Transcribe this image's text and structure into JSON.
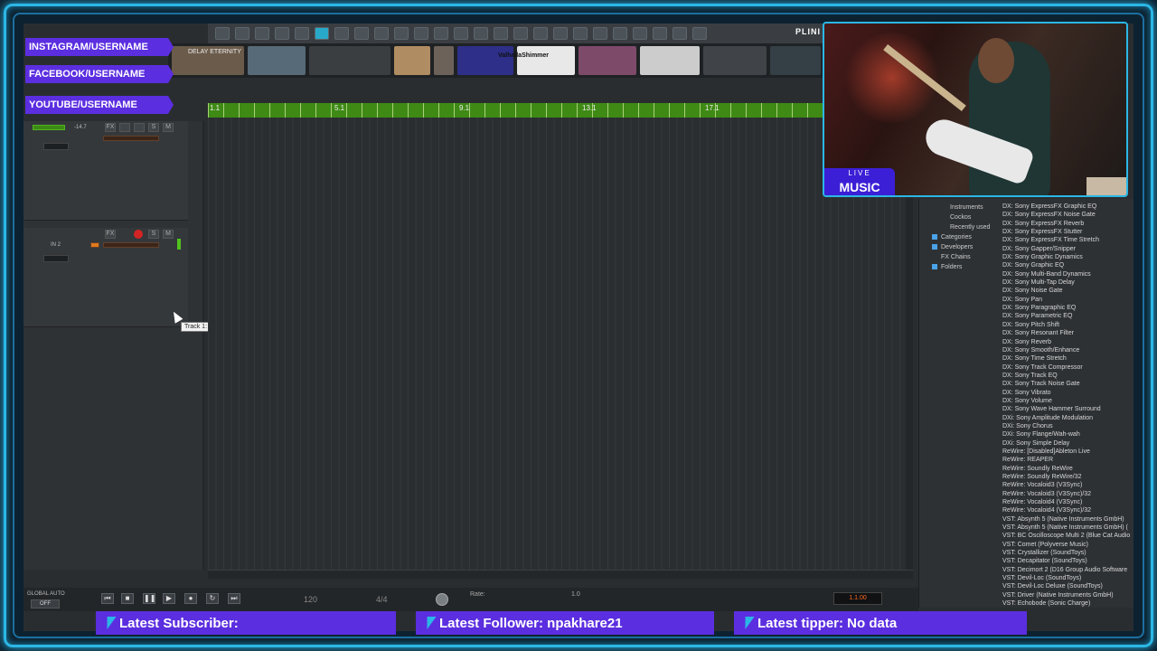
{
  "social": {
    "instagram": "INSTAGRAM/USERNAME",
    "facebook": "FACEBOOK/USERNAME",
    "youtube": "YOUTUBE/USERNAME"
  },
  "plugins": {
    "delay_label": "DELAY ETERNITY",
    "valhalla_label": "ValhallaShimmer",
    "plini_label": "PLINI"
  },
  "ruler": {
    "marks": [
      "1.1",
      "5.1",
      "9.1",
      "13.1",
      "17.1"
    ]
  },
  "tracks": [
    {
      "level": "-14.7",
      "fx": "FX",
      "solo": "S",
      "mute": "M"
    },
    {
      "input": "IN 2",
      "fx": "FX",
      "solo": "S",
      "mute": "M"
    }
  ],
  "tooltip": "Track 1:",
  "transport": {
    "global_auto": "GLOBAL AUTO",
    "global_auto_state": "OFF",
    "bpm": "120",
    "time_sig": "4/4",
    "rate_label": "Rate:",
    "rate_value": "1.0",
    "position": "1.1.00"
  },
  "fx_tree": [
    {
      "label": "Instruments",
      "box": false
    },
    {
      "label": "Cockos",
      "box": false
    },
    {
      "label": "Recently used",
      "box": false
    },
    {
      "label": "Categories",
      "box": true
    },
    {
      "label": "Developers",
      "box": true
    },
    {
      "label": "FX Chains",
      "box": false
    },
    {
      "label": "Folders",
      "box": true
    }
  ],
  "fx_list": [
    "DX: Sony ExpressFX Graphic EQ",
    "DX: Sony ExpressFX Noise Gate",
    "DX: Sony ExpressFX Reverb",
    "DX: Sony ExpressFX Stutter",
    "DX: Sony ExpressFX Time Stretch",
    "DX: Sony Gapper/Snipper",
    "DX: Sony Graphic Dynamics",
    "DX: Sony Graphic EQ",
    "DX: Sony Multi-Band Dynamics",
    "DX: Sony Multi-Tap Delay",
    "DX: Sony Noise Gate",
    "DX: Sony Pan",
    "DX: Sony Paragraphic EQ",
    "DX: Sony Parametric EQ",
    "DX: Sony Pitch Shift",
    "DX: Sony Resonant Filter",
    "DX: Sony Reverb",
    "DX: Sony Smooth/Enhance",
    "DX: Sony Time Stretch",
    "DX: Sony Track Compressor",
    "DX: Sony Track EQ",
    "DX: Sony Track Noise Gate",
    "DX: Sony Vibrato",
    "DX: Sony Volume",
    "DX: Sony Wave Hammer Surround",
    "DXi: Sony Amplitude Modulation",
    "DXi: Sony Chorus",
    "DXi: Sony Flange/Wah-wah",
    "DXi: Sony Simple Delay",
    "ReWire: [Disabled]Ableton Live",
    "ReWire: REAPER",
    "ReWire: Soundly ReWire",
    "ReWire: Soundly ReWire/32",
    "ReWire: Vocaloid3 (V3Sync)",
    "ReWire: Vocaloid3 (V3Sync)/32",
    "ReWire: Vocaloid4 (V3Sync)",
    "ReWire: Vocaloid4 (V3Sync)/32",
    "VST: Absynth 5 (Native Instruments GmbH)",
    "VST: Absynth 5 (Native Instruments GmbH) (",
    "VST: BC Oscilloscope Multi 2 (Blue Cat Audio",
    "VST: Comet (Polyverse Music)",
    "VST: Crystallizer (SoundToys)",
    "VST: Decapitator (SoundToys)",
    "VST: Decimort 2 (D16 Group Audio Software",
    "VST: Devil-Loc (SoundToys)",
    "VST: Devil-Loc Deluxe (SoundToys)",
    "VST: Driver (Native Instruments GmbH)",
    "VST: Echobode (Sonic Charge)"
  ],
  "webcam": {
    "live_top": "LIVE",
    "live_music": "MUSIC"
  },
  "ticker": {
    "subscriber": "Latest Subscriber:",
    "follower": "Latest Follower: npakhare21",
    "tipper": "Latest tipper: No data"
  },
  "colors": {
    "accent": "#2bb7e6",
    "banner": "#5b2ee0",
    "ruler": "#3e8a15"
  }
}
